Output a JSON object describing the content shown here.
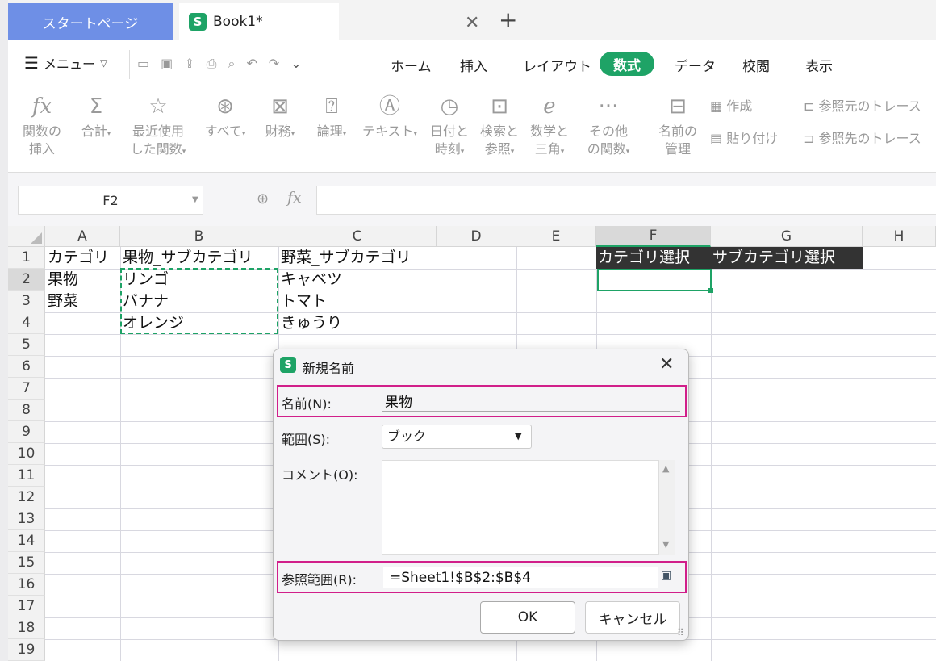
{
  "tabs": {
    "start_page": "スタートページ",
    "book": "Book1*",
    "close": "✕",
    "add": "+"
  },
  "menu": {
    "menu_label": "メニュー",
    "ribbon_tabs": [
      "ホーム",
      "挿入",
      "レイアウト",
      "数式",
      "データ",
      "校閲",
      "表示"
    ]
  },
  "ribbon": {
    "insert_function": [
      "関数の",
      "挿入"
    ],
    "sum": "合計",
    "recent": [
      "最近使用",
      "した関数"
    ],
    "all": "すべて",
    "financial": "財務",
    "logical": "論理",
    "text": "テキスト",
    "datetime": [
      "日付と",
      "時刻"
    ],
    "lookup": [
      "検索と",
      "参照"
    ],
    "math": [
      "数学と",
      "三角"
    ],
    "more": [
      "その他",
      "の関数"
    ],
    "name_manager": [
      "名前の",
      "管理"
    ],
    "create": "作成",
    "paste": "貼り付け",
    "trace_precedents": "参照元のトレース",
    "trace_dependents": "参照先のトレース"
  },
  "formula_bar": {
    "namebox": "F2",
    "fx": "fx"
  },
  "grid": {
    "columns": [
      "A",
      "B",
      "C",
      "D",
      "E",
      "F",
      "G",
      "H"
    ],
    "rows": [
      "1",
      "2",
      "3",
      "4",
      "5",
      "6",
      "7",
      "8",
      "9",
      "10",
      "11",
      "12",
      "13",
      "14",
      "15",
      "16",
      "17",
      "18",
      "19"
    ],
    "cells": {
      "A1": "カテゴリ",
      "A2": "果物",
      "A3": "野菜",
      "B1": "果物_サブカテゴリ",
      "B2": "リンゴ",
      "B3": "バナナ",
      "B4": "オレンジ",
      "C1": "野菜_サブカテゴリ",
      "C2": "キャベツ",
      "C3": "トマト",
      "C4": "きゅうり",
      "F1": "カテゴリ選択",
      "G1": "サブカテゴリ選択"
    }
  },
  "dialog": {
    "title": "新規名前",
    "close": "✕",
    "name_label": "名前(N):",
    "name_value": "果物",
    "scope_label": "範囲(S):",
    "scope_value": "ブック",
    "comment_label": "コメント(O):",
    "ref_label": "参照範囲(R):",
    "ref_value": "=Sheet1!$B$2:$B$4",
    "ok": "OK",
    "cancel": "キャンセル"
  },
  "colors": {
    "accent_green": "#1ea366",
    "highlight_magenta": "#d11f8a",
    "start_tab_blue": "#6e8fe6",
    "header_dark": "#333333"
  }
}
